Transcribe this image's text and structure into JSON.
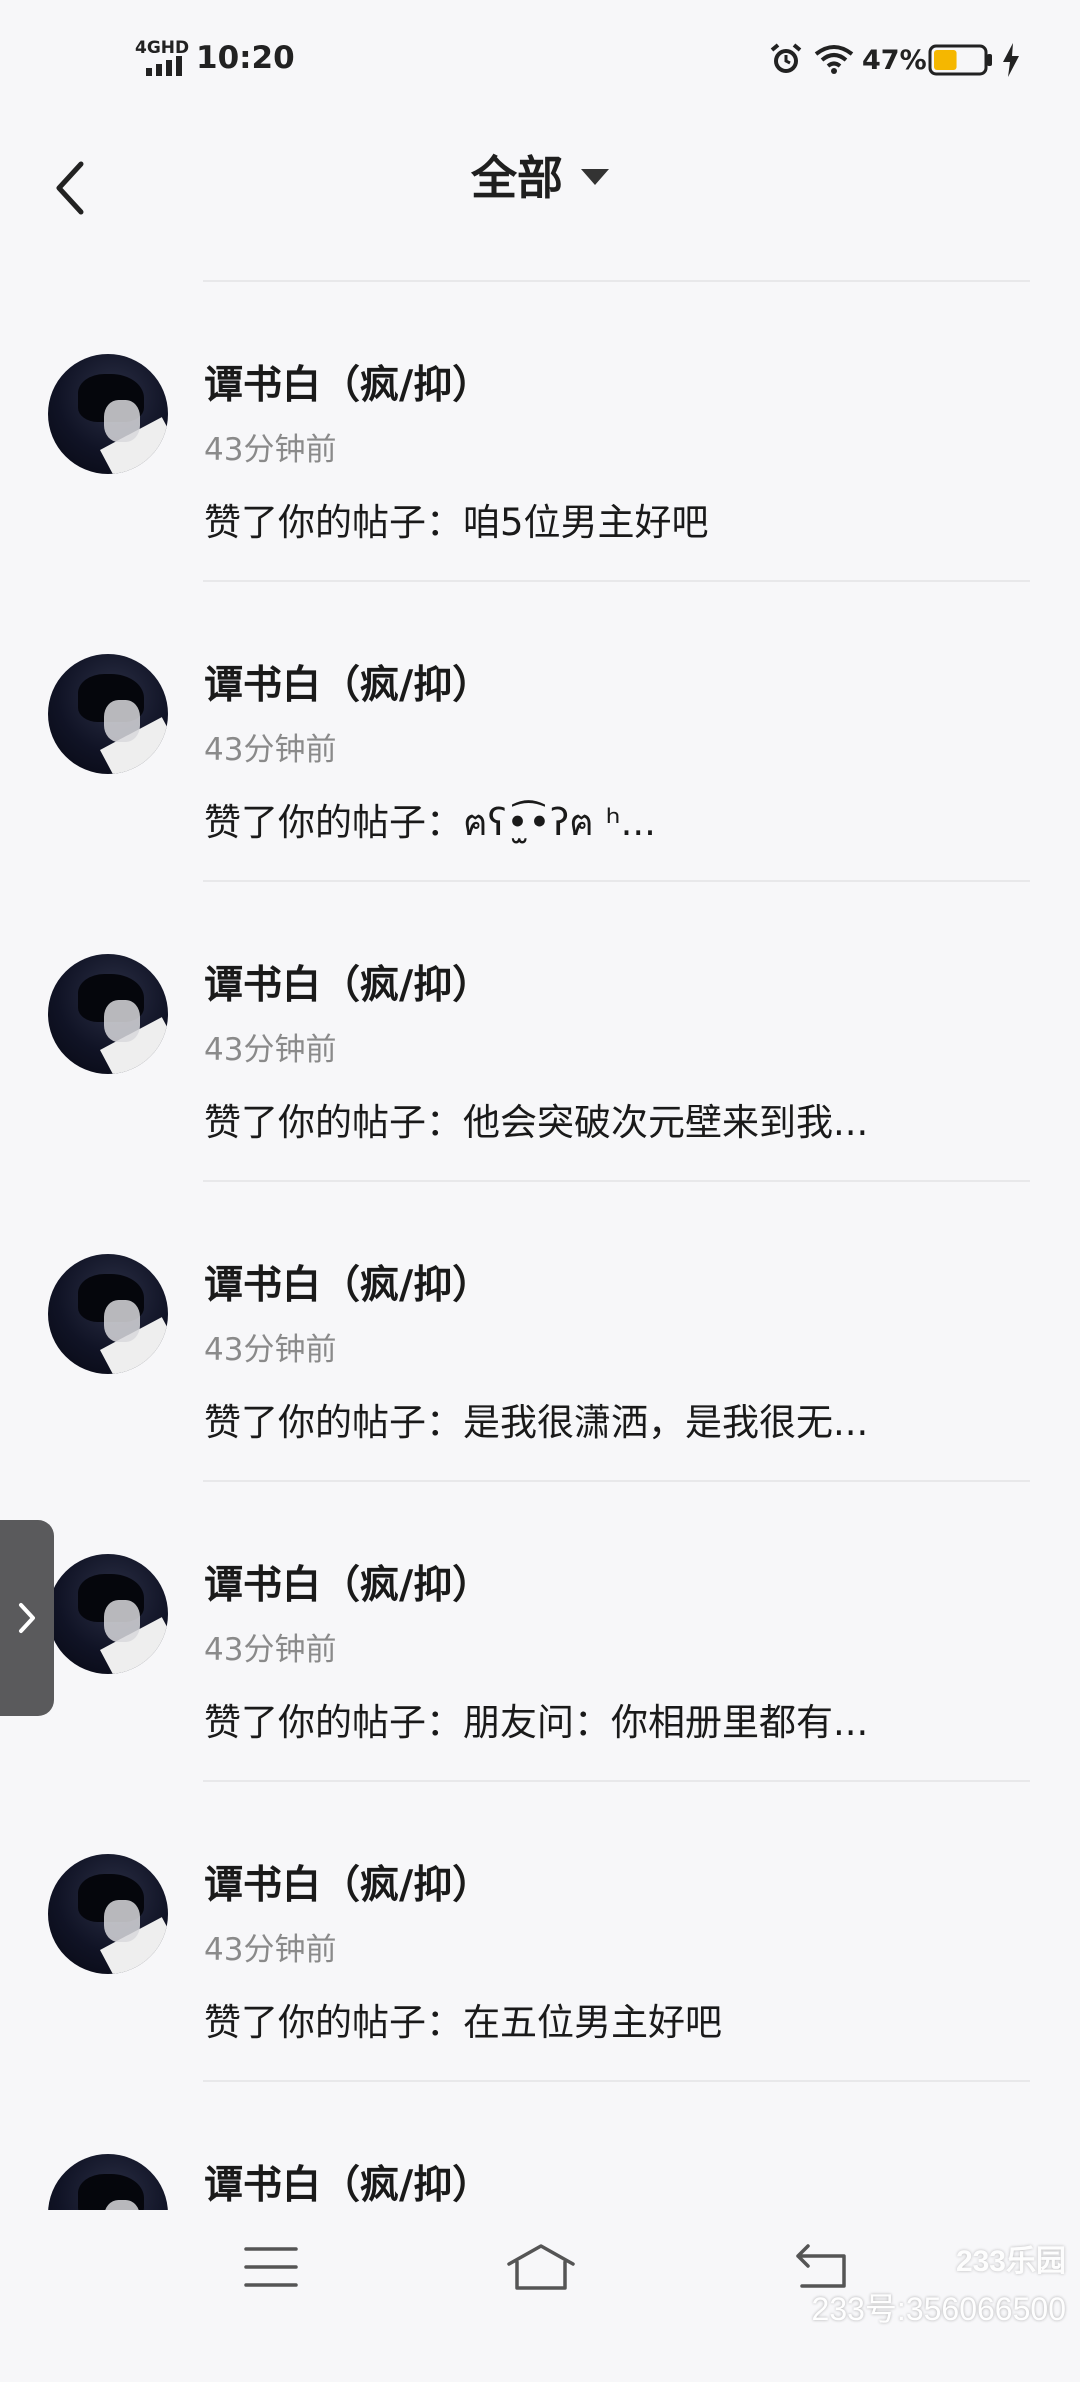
{
  "status_bar": {
    "network": "4GHD",
    "time": "10:20",
    "battery": "47%",
    "icons": [
      "signal-icon",
      "alarm-icon",
      "wifi-icon",
      "battery-icon",
      "charging-icon"
    ],
    "battery_level": 0.47,
    "battery_color": "#f5b700"
  },
  "header": {
    "title": "全部",
    "back_icon": "chevron-left-icon",
    "dropdown_icon": "caret-down-icon"
  },
  "notifications": [
    {
      "name": "谭书白（疯/抑）",
      "time": "43分钟前",
      "message": "赞了你的帖子：咱5位男主好吧"
    },
    {
      "name": "谭书白（疯/抑）",
      "time": "43分钟前",
      "message": "赞了你的帖子：ฅʕ•̫͡•ʔฅ ʰ..."
    },
    {
      "name": "谭书白（疯/抑）",
      "time": "43分钟前",
      "message": "赞了你的帖子：他会突破次元壁来到我..."
    },
    {
      "name": "谭书白（疯/抑）",
      "time": "43分钟前",
      "message": "赞了你的帖子：是我很潇洒，是我很无..."
    },
    {
      "name": "谭书白（疯/抑）",
      "time": "43分钟前",
      "message": "赞了你的帖子：朋友问：你相册里都有..."
    },
    {
      "name": "谭书白（疯/抑）",
      "time": "43分钟前",
      "message": "赞了你的帖子：在五位男主好吧"
    },
    {
      "name": "谭书白（疯/抑）",
      "time": "",
      "message": ""
    }
  ],
  "side_handle": {
    "icon": "chevron-right-icon"
  },
  "nav_bar": {
    "icons": [
      "menu-icon",
      "home-icon",
      "return-icon"
    ]
  },
  "watermark": {
    "logo": "233乐园",
    "id": "233号:356066500"
  }
}
